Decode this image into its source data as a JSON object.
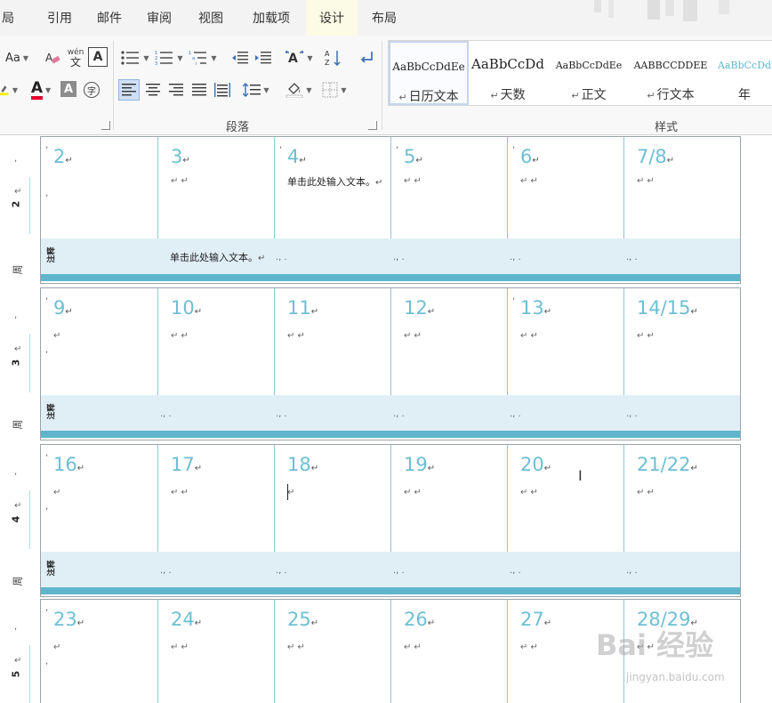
{
  "tabs": [
    {
      "label": "局",
      "active": false
    },
    {
      "label": "引用",
      "active": false
    },
    {
      "label": "邮件",
      "active": false
    },
    {
      "label": "审阅",
      "active": false
    },
    {
      "label": "视图",
      "active": false
    },
    {
      "label": "加载项",
      "active": false
    },
    {
      "label": "设计",
      "active": true
    },
    {
      "label": "布局",
      "active": false
    }
  ],
  "ribbon": {
    "font_size_label": "Aa",
    "phonetic_label": "wén",
    "phonetic_char": "文",
    "char_border_label": "A",
    "font_color_label": "A",
    "shade_label": "A",
    "enclose_label": "字",
    "paragraph_group": "段落",
    "styles_group": "样式"
  },
  "styles": [
    {
      "preview": "AaBbCcDdEe",
      "name": "日历文本",
      "selected": true
    },
    {
      "preview": "AaBbCcDd",
      "name": "天数",
      "selected": false
    },
    {
      "preview": "AaBbCcDdEe",
      "name": "正文",
      "selected": false
    },
    {
      "preview": "AABBCCDDEE",
      "name": "行文本",
      "selected": false
    },
    {
      "preview": "AaBbCcDdEe",
      "name": "年",
      "selected": false
    }
  ],
  "calendar": {
    "note_label": "注释",
    "week_word": "周",
    "placeholder": "单击此处输入文本。",
    "weeks": [
      {
        "week": "2",
        "days": [
          "2",
          "3",
          "4",
          "5",
          "6",
          "7/8"
        ]
      },
      {
        "week": "3",
        "days": [
          "9",
          "10",
          "11",
          "12",
          "13",
          "14/15"
        ]
      },
      {
        "week": "4",
        "days": [
          "16",
          "17",
          "18",
          "19",
          "20",
          "21/22"
        ]
      },
      {
        "week": "5",
        "days": [
          "23",
          "24",
          "25",
          "26",
          "27",
          "28/29"
        ]
      }
    ]
  },
  "watermark": {
    "logo": "Bai 经验",
    "url": "jingyan.baidu.com"
  }
}
